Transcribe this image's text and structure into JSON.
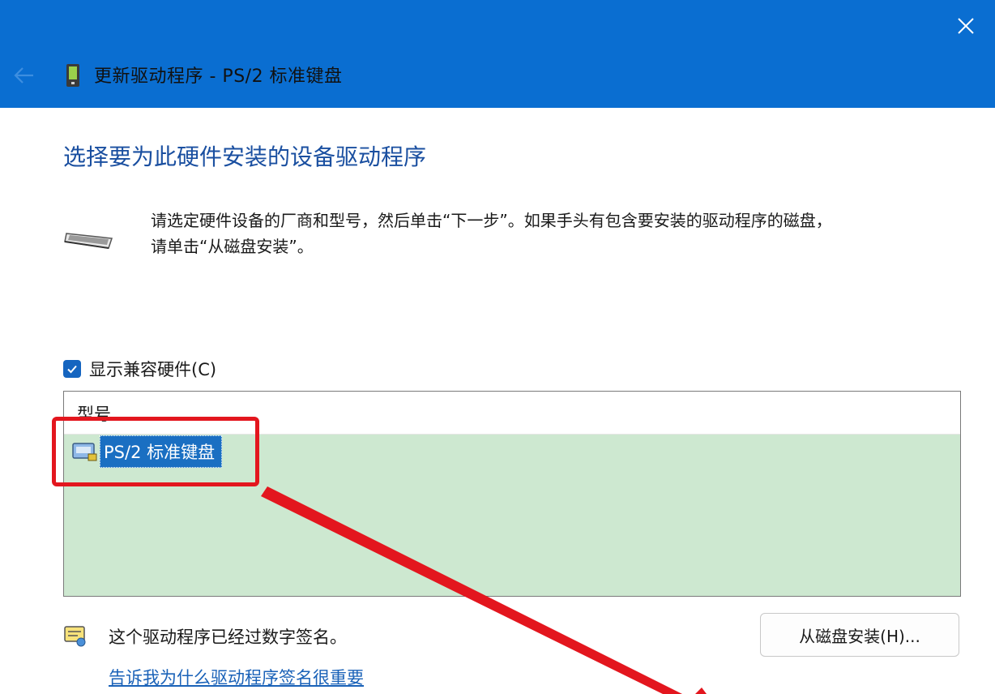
{
  "window": {
    "title": "更新驱动程序 - PS/2 标准键盘"
  },
  "main": {
    "heading": "选择要为此硬件安装的设备驱动程序",
    "description_line1": "请选定硬件设备的厂商和型号，然后单击“下一步”。如果手头有包含要安装的驱动程序的磁盘，",
    "description_line2": "请单击“从磁盘安装”。",
    "show_compatible_label": "显示兼容硬件(C)",
    "show_compatible_checked": true
  },
  "model_list": {
    "header": "型号",
    "items": [
      {
        "label": "PS/2 标准键盘",
        "selected": true
      }
    ]
  },
  "footer": {
    "signed_text": "这个驱动程序已经过数字签名。",
    "help_link": "告诉我为什么驱动程序签名很重要",
    "have_disk_button": "从磁盘安装(H)..."
  },
  "icons": {
    "close": "close-icon",
    "back": "back-arrow-icon",
    "device": "device-icon",
    "keyboard": "keyboard-icon",
    "list_item": "keyboard-device-icon",
    "certificate": "certificate-icon",
    "checkmark": "checkmark-icon"
  },
  "colors": {
    "titlebar": "#0a6ed1",
    "heading": "#1a4fa0",
    "list_background": "#cde8d0",
    "selection": "#1a6fc2",
    "annotation": "#e3161e",
    "link": "#1a62b8"
  }
}
